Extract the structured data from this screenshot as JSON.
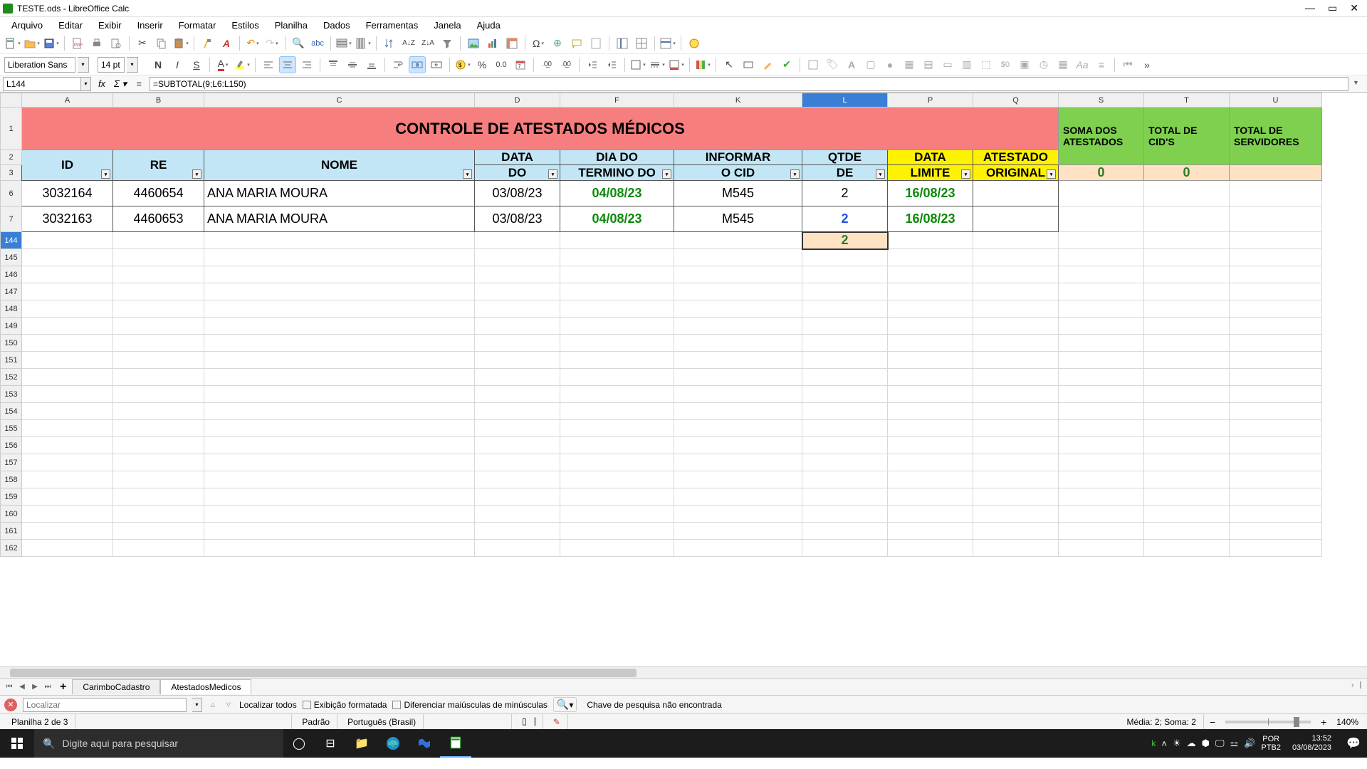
{
  "window": {
    "title": "TESTE.ods - LibreOffice Calc"
  },
  "menu": [
    "Arquivo",
    "Editar",
    "Exibir",
    "Inserir",
    "Formatar",
    "Estilos",
    "Planilha",
    "Dados",
    "Ferramentas",
    "Janela",
    "Ajuda"
  ],
  "font": {
    "name": "Liberation Sans",
    "size": "14 pt"
  },
  "formula": {
    "cell_ref": "L144",
    "value": "=SUBTOTAL(9;L6:L150)"
  },
  "columns": [
    "A",
    "B",
    "C",
    "D",
    "F",
    "K",
    "L",
    "P",
    "Q",
    "S",
    "T",
    "U"
  ],
  "title_row": "CONTROLE DE ATESTADOS MÉDICOS",
  "green_headers": {
    "S": "SOMA DOS ATESTADOS",
    "T": "TOTAL DE  CID'S",
    "U": "TOTAL DE SERVIDORES"
  },
  "peach_vals": {
    "S": "0",
    "T": "0",
    "U": ""
  },
  "table_head_top": {
    "A": "",
    "B": "",
    "C": "",
    "D": "DATA",
    "F": "DIA DO",
    "K": "INFORMAR",
    "L": "QTDE",
    "P": "DATA",
    "Q": "ATESTADO"
  },
  "table_head_bot": {
    "A": "ID",
    "B": "RE",
    "C": "NOME",
    "D": "DO",
    "F": "TERMINO DO",
    "K": "O CID",
    "L": "DE",
    "P": "LIMITE",
    "Q": "ORIGINAL"
  },
  "rows": [
    {
      "rn": "6",
      "A": "3032164",
      "B": "4460654",
      "C": "ANA MARIA MOURA",
      "D": "03/08/23",
      "F": "04/08/23",
      "K": "M545",
      "L": "2",
      "P": "16/08/23",
      "Q": ""
    },
    {
      "rn": "7",
      "A": "3032163",
      "B": "4460653",
      "C": "ANA MARIA MOURA",
      "D": "03/08/23",
      "F": "04/08/23",
      "K": "M545",
      "L": "2",
      "P": "16/08/23",
      "Q": ""
    }
  ],
  "subtotal_row": {
    "rn": "144",
    "L": "2"
  },
  "empty_rows": [
    "145",
    "146",
    "147",
    "148",
    "149",
    "150",
    "151",
    "152",
    "153",
    "154",
    "155",
    "156",
    "157",
    "158",
    "159",
    "160",
    "161",
    "162"
  ],
  "tabs": {
    "list": [
      "CarimboCadastro",
      "AtestadosMedicos"
    ],
    "active": 1
  },
  "find": {
    "placeholder": "Localizar",
    "find_all": "Localizar todos",
    "chk_format": "Exibição formatada",
    "chk_case": "Diferenciar maiúsculas de minúsculas",
    "msg": "Chave de pesquisa não encontrada"
  },
  "status": {
    "sheet": "Planilha 2 de 3",
    "mode": "Padrão",
    "lang": "Português (Brasil)",
    "aggregate": "Média: 2; Soma: 2",
    "zoom": "140%"
  },
  "taskbar": {
    "search_placeholder": "Digite aqui para pesquisar",
    "lang1": "POR",
    "lang2": "PTB2",
    "time": "13:52",
    "date": "03/08/2023"
  }
}
